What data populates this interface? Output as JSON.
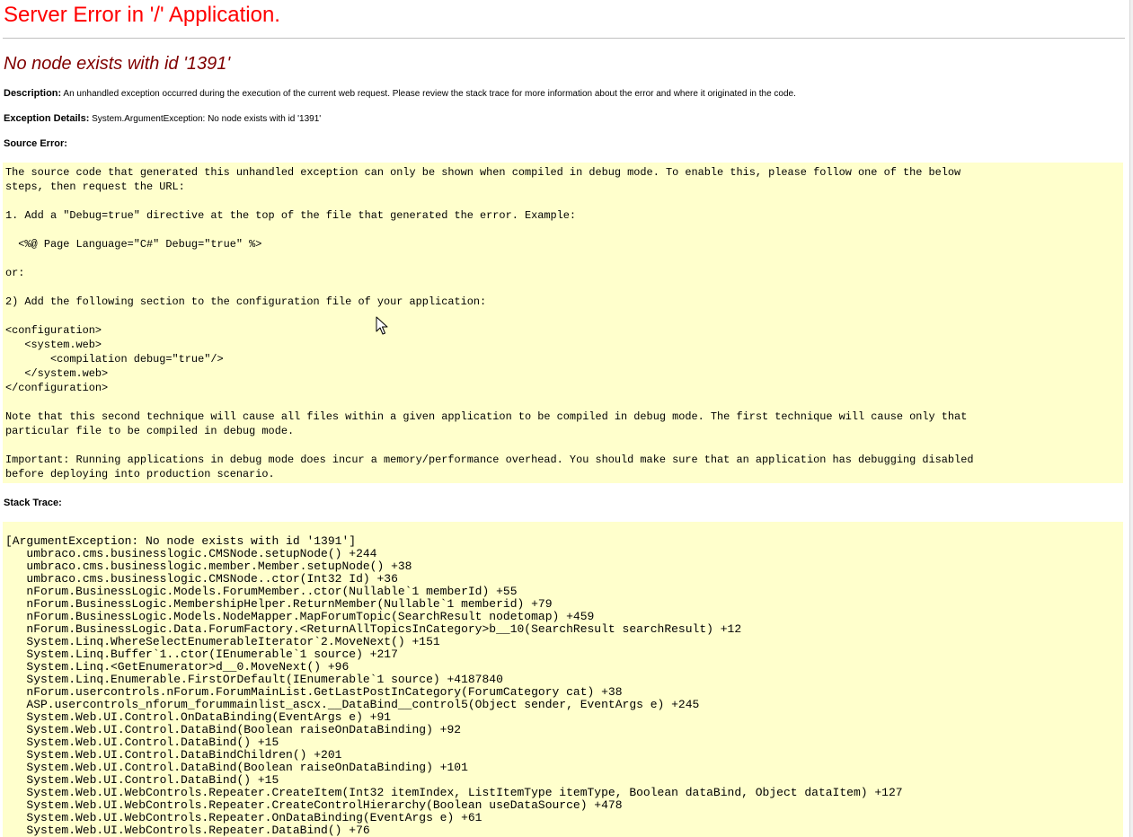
{
  "header": {
    "title": "Server Error in '/' Application.",
    "subtitle": "No node exists with id '1391'"
  },
  "description": {
    "label": "Description:",
    "text": "An unhandled exception occurred during the execution of the current web request. Please review the stack trace for more information about the error and where it originated in the code."
  },
  "exception_details": {
    "label": "Exception Details:",
    "text": "System.ArgumentException: No node exists with id '1391'"
  },
  "source_error": {
    "label": "Source Error:",
    "lines": [
      "The source code that generated this unhandled exception can only be shown when compiled in debug mode. To enable this, please follow one of the below",
      "steps, then request the URL:",
      "",
      "1. Add a \"Debug=true\" directive at the top of the file that generated the error. Example:",
      "",
      "  <%@ Page Language=\"C#\" Debug=\"true\" %>",
      "",
      "or:",
      "",
      "2) Add the following section to the configuration file of your application:",
      "",
      "<configuration>",
      "   <system.web>",
      "       <compilation debug=\"true\"/>",
      "   </system.web>",
      "</configuration>",
      "",
      "Note that this second technique will cause all files within a given application to be compiled in debug mode. The first technique will cause only that",
      "particular file to be compiled in debug mode.",
      "",
      "Important: Running applications in debug mode does incur a memory/performance overhead. You should make sure that an application has debugging disabled",
      "before deploying into production scenario."
    ]
  },
  "stack_trace": {
    "label": "Stack Trace:",
    "lines": [
      "[ArgumentException: No node exists with id '1391']",
      "   umbraco.cms.businesslogic.CMSNode.setupNode() +244",
      "   umbraco.cms.businesslogic.member.Member.setupNode() +38",
      "   umbraco.cms.businesslogic.CMSNode..ctor(Int32 Id) +36",
      "   nForum.BusinessLogic.Models.ForumMember..ctor(Nullable`1 memberId) +55",
      "   nForum.BusinessLogic.MembershipHelper.ReturnMember(Nullable`1 memberid) +79",
      "   nForum.BusinessLogic.Models.NodeMapper.MapForumTopic(SearchResult nodetomap) +459",
      "   nForum.BusinessLogic.Data.ForumFactory.<ReturnAllTopicsInCategory>b__10(SearchResult searchResult) +12",
      "   System.Linq.WhereSelectEnumerableIterator`2.MoveNext() +151",
      "   System.Linq.Buffer`1..ctor(IEnumerable`1 source) +217",
      "   System.Linq.<GetEnumerator>d__0.MoveNext() +96",
      "   System.Linq.Enumerable.FirstOrDefault(IEnumerable`1 source) +4187840",
      "   nForum.usercontrols.nForum.ForumMainList.GetLastPostInCategory(ForumCategory cat) +38",
      "   ASP.usercontrols_nforum_forummainlist_ascx.__DataBind__control5(Object sender, EventArgs e) +245",
      "   System.Web.UI.Control.OnDataBinding(EventArgs e) +91",
      "   System.Web.UI.Control.DataBind(Boolean raiseOnDataBinding) +92",
      "   System.Web.UI.Control.DataBind() +15",
      "   System.Web.UI.Control.DataBindChildren() +201",
      "   System.Web.UI.Control.DataBind(Boolean raiseOnDataBinding) +101",
      "   System.Web.UI.Control.DataBind() +15",
      "   System.Web.UI.WebControls.Repeater.CreateItem(Int32 itemIndex, ListItemType itemType, Boolean dataBind, Object dataItem) +127",
      "   System.Web.UI.WebControls.Repeater.CreateControlHierarchy(Boolean useDataSource) +478",
      "   System.Web.UI.WebControls.Repeater.OnDataBinding(EventArgs e) +61",
      "   System.Web.UI.WebControls.Repeater.DataBind() +76"
    ]
  },
  "colors": {
    "title": "#ff0000",
    "subtitle": "#800000",
    "code_background": "#ffffcc"
  },
  "icons": {
    "cursor": "mouse-pointer-icon"
  }
}
